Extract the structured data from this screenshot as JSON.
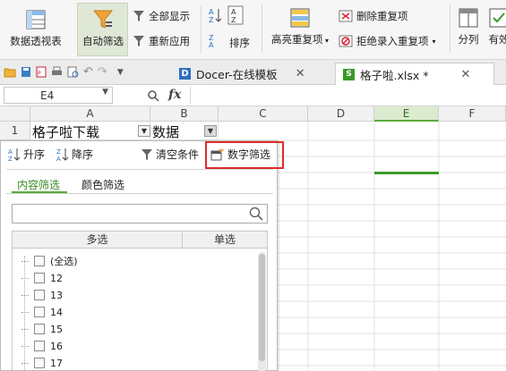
{
  "ribbon": {
    "pivot_table": "数据透视表",
    "auto_filter": "自动筛选",
    "show_all": "全部显示",
    "reapply": "重新应用",
    "sort": "排序",
    "highlight_duplicates": "高亮重复项",
    "remove_duplicates": "删除重复项",
    "reject_duplicates": "拒绝录入重复项",
    "split": "分列",
    "valid": "有效"
  },
  "tabs": {
    "docer": "Docer-在线模板",
    "file": "格子啦.xlsx *"
  },
  "formula_bar": {
    "name_box": "E4",
    "fx": "fx"
  },
  "columns": [
    "A",
    "B",
    "C",
    "D",
    "E",
    "F"
  ],
  "rows": [
    "1"
  ],
  "cells": {
    "a1": "格子啦下载",
    "b1": "数据"
  },
  "filter_panel": {
    "sort_asc": "升序",
    "sort_desc": "降序",
    "clear": "清空条件",
    "number_filter": "数字筛选",
    "tab_content": "内容筛选",
    "tab_color": "颜色筛选",
    "search_placeholder": "",
    "col_multi": "多选",
    "col_single": "单选",
    "items": [
      "(全选)",
      "12",
      "13",
      "14",
      "15",
      "16",
      "17"
    ]
  },
  "colors": {
    "accent_green": "#5bab3c",
    "highlight_red": "#e02b2b"
  }
}
